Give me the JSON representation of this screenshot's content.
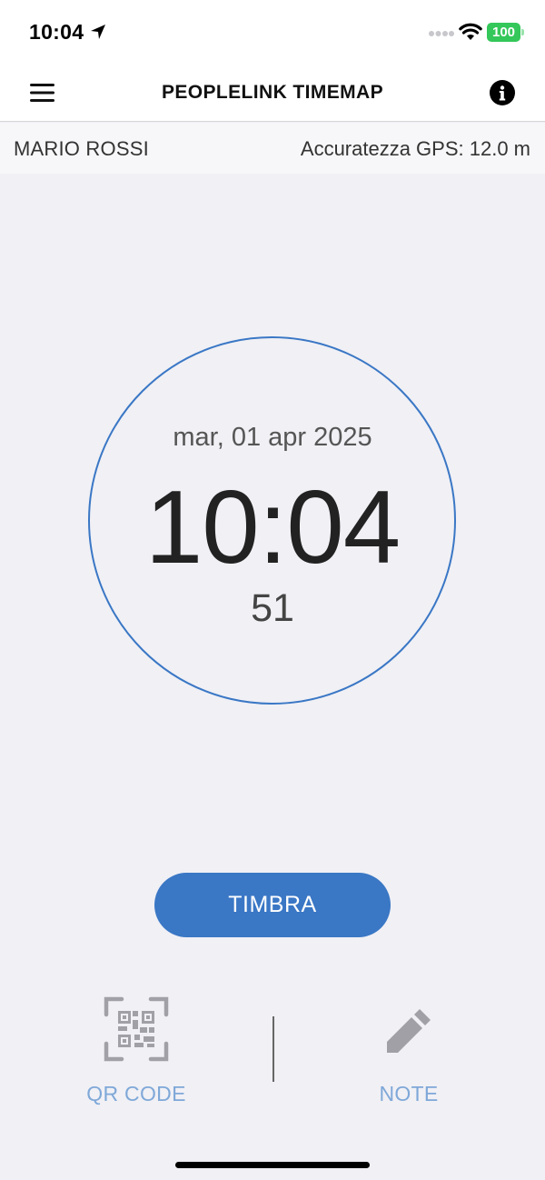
{
  "status_bar": {
    "time": "10:04",
    "battery": "100"
  },
  "nav": {
    "title": "PEOPLELINK TIMEMAP",
    "menu_icon": "hamburger-icon",
    "info_icon": "info-icon"
  },
  "user": {
    "name": "MARIO ROSSI",
    "gps_accuracy": "Accuratezza GPS: 12.0 m"
  },
  "clock": {
    "date": "mar, 01 apr 2025",
    "time": "10:04",
    "seconds": "51",
    "ring_color": "#3a77c5"
  },
  "actions": {
    "timbra_label": "TIMBRA",
    "qr_label": "QR CODE",
    "qr_icon": "qr-code-icon",
    "note_label": "NOTE",
    "note_icon": "pencil-icon"
  },
  "colors": {
    "accent": "#3a77c5",
    "action_label": "#7fa8d8",
    "battery": "#34c759"
  }
}
